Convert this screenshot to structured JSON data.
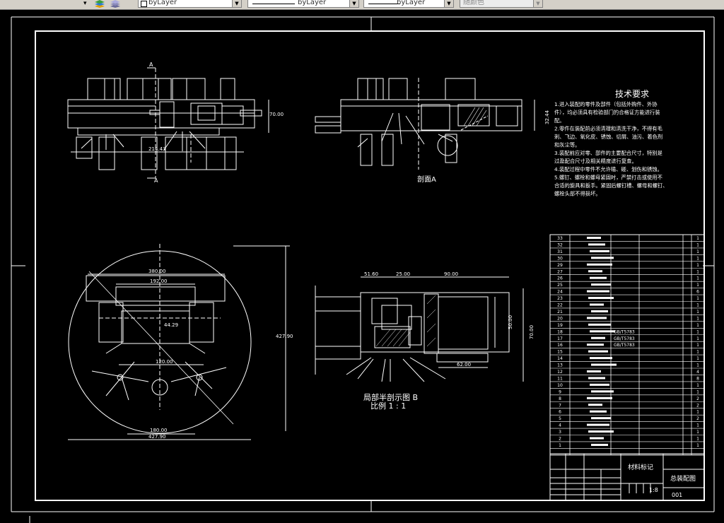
{
  "toolbar": {
    "arrow_left": "▾",
    "combo1": {
      "label": "byLayer"
    },
    "combo2": {
      "label": "byLayer"
    },
    "combo3": {
      "label": "byLayer"
    },
    "combo4": {
      "label": "随颜色"
    }
  },
  "views": {
    "top_left": {
      "section_mark": "A",
      "dim_width": "214.43",
      "dim_height": "70.00"
    },
    "top_mid": {
      "label": "剖面A",
      "dim_height": "32.44"
    },
    "bottom_left": {
      "dims": [
        "380.00",
        "192.00",
        "44.29",
        "120.00",
        "180.00",
        "427.90",
        "427.90"
      ]
    },
    "bottom_mid": {
      "title": "局部半剖示图 B",
      "scale": "比例 1 : 1",
      "dims": [
        "51.60",
        "25.00",
        "90.00",
        "50.00",
        "70.00",
        "62.00"
      ]
    }
  },
  "tech_req": {
    "title": "技术要求",
    "lines": [
      "1.进入装配的零件及部件（包括外购件、外协",
      "件），均必须具有检验部门的合格证方能进行装",
      "配。",
      "2.零件在装配前必须清理和清洗干净，不得有毛",
      "刺、飞边、氧化皮、锈蚀、切屑、油污、着色剂",
      "和灰尘等。",
      "3.装配前应对零、部件的主要配合尺寸，特别是",
      "过盈配合尺寸及相关精度进行复查。",
      "4.装配过程中零件不允许磕、碰、划伤和锈蚀。",
      "5.螺钉、螺栓和螺母紧固时，严禁打击或使用不",
      "合适的旋具和扳手。紧固后螺钉槽、螺母和螺钉、",
      "螺栓头部不得损坏。"
    ]
  },
  "bom": {
    "rows": [
      {
        "no": "33",
        "code": "",
        "name": "",
        "qty": "1"
      },
      {
        "no": "32",
        "code": "",
        "name": "",
        "qty": "1"
      },
      {
        "no": "31",
        "code": "",
        "name": "",
        "qty": "1"
      },
      {
        "no": "30",
        "code": "",
        "name": "",
        "qty": "1"
      },
      {
        "no": "29",
        "code": "",
        "name": "",
        "qty": "1"
      },
      {
        "no": "27",
        "code": "",
        "name": "",
        "qty": "1"
      },
      {
        "no": "26",
        "code": "",
        "name": "",
        "qty": "1"
      },
      {
        "no": "25",
        "code": "",
        "name": "",
        "qty": "1"
      },
      {
        "no": "24",
        "code": "",
        "name": "",
        "qty": "6"
      },
      {
        "no": "23",
        "code": "",
        "name": "",
        "qty": "1"
      },
      {
        "no": "22",
        "code": "",
        "name": "",
        "qty": "1"
      },
      {
        "no": "21",
        "code": "",
        "name": "",
        "qty": "1"
      },
      {
        "no": "20",
        "code": "",
        "name": "",
        "qty": "1"
      },
      {
        "no": "19",
        "code": "",
        "name": "",
        "qty": "1"
      },
      {
        "no": "18",
        "code": "",
        "name": "",
        "qty": "1"
      },
      {
        "no": "17",
        "code": "",
        "name": "",
        "qty": "1"
      },
      {
        "no": "16",
        "code": "",
        "name": "",
        "qty": "1"
      },
      {
        "no": "15",
        "code": "",
        "name": "",
        "qty": "1"
      },
      {
        "no": "14",
        "code": "",
        "name": "",
        "qty": "1"
      },
      {
        "no": "13",
        "code": "",
        "name": "",
        "qty": "1"
      },
      {
        "no": "12",
        "code": "",
        "name": "",
        "qty": "4"
      },
      {
        "no": "11",
        "code": "",
        "name": "",
        "qty": "8"
      },
      {
        "no": "10",
        "code": "",
        "name": "",
        "qty": "1"
      },
      {
        "no": "9",
        "code": "",
        "name": "",
        "qty": "1"
      },
      {
        "no": "8",
        "code": "",
        "name": "",
        "qty": "2"
      },
      {
        "no": "7",
        "code": "",
        "name": "",
        "qty": "2"
      },
      {
        "no": "6",
        "code": "",
        "name": "",
        "qty": "1"
      },
      {
        "no": "5",
        "code": "",
        "name": "",
        "qty": "2"
      },
      {
        "no": "4",
        "code": "",
        "name": "",
        "qty": "1"
      },
      {
        "no": "3",
        "code": "",
        "name": "",
        "qty": "1"
      },
      {
        "no": "2",
        "code": "",
        "name": "",
        "qty": "1"
      },
      {
        "no": "1",
        "code": "",
        "name": "",
        "qty": "1"
      }
    ],
    "std_1": "GB/T5783",
    "std_2": "GB/T5783",
    "std_3": "GB/T5783"
  },
  "title_block": {
    "material": "材料标记",
    "drawing_name": "总装配图",
    "scale": "1:8",
    "number": "001"
  }
}
